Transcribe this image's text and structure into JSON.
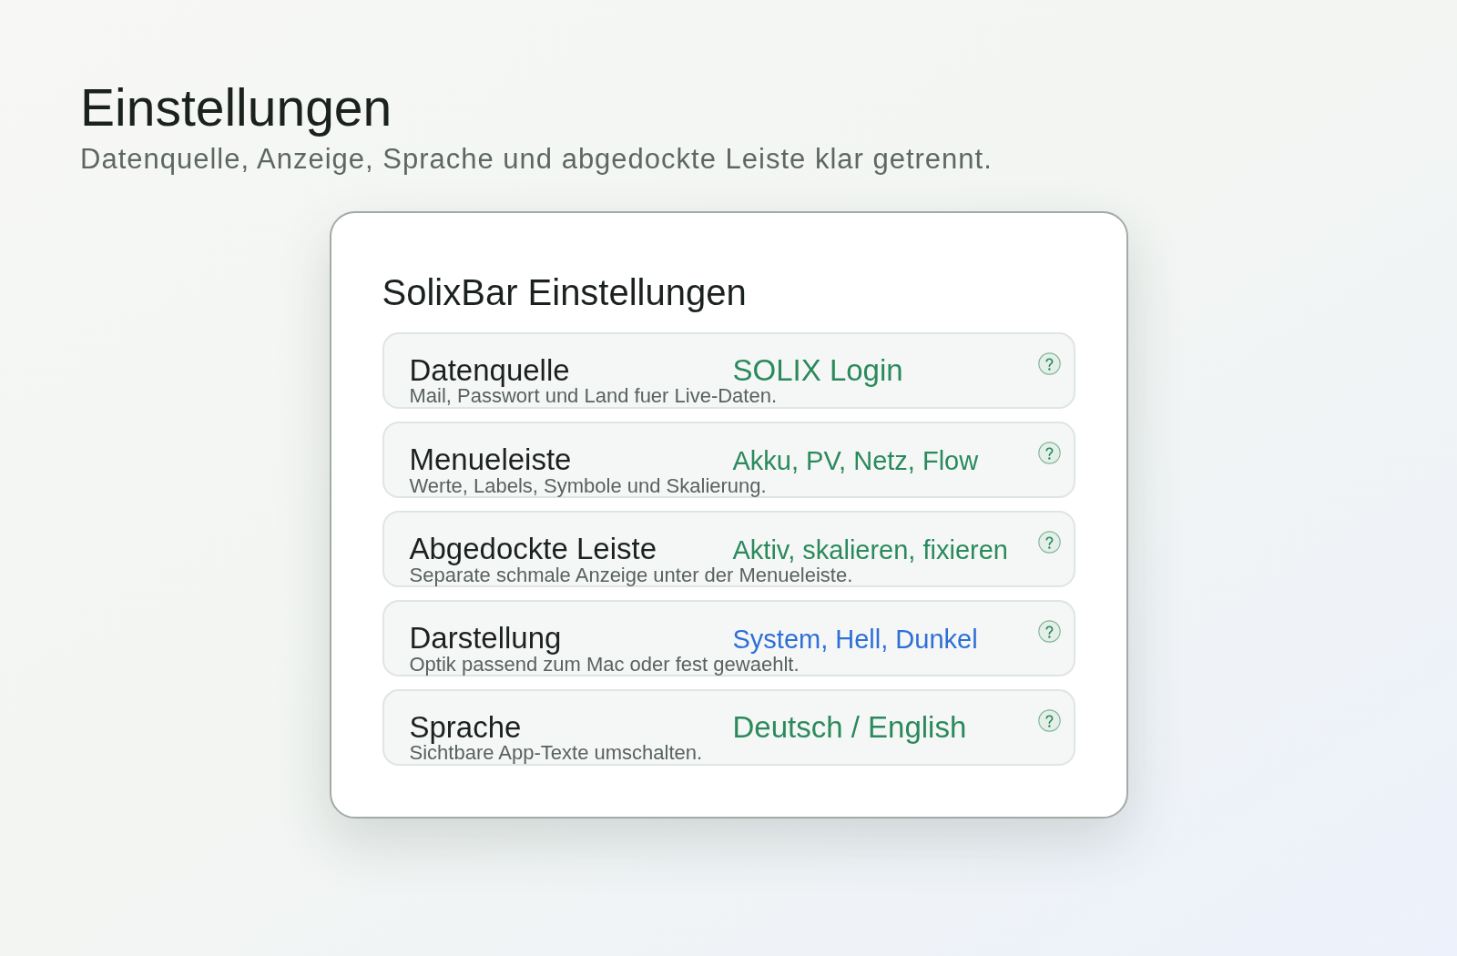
{
  "page": {
    "title": "Einstellungen",
    "subtitle": "Datenquelle, Anzeige, Sprache und abgedockte Leiste klar getrennt."
  },
  "settings_window": {
    "title": "SolixBar Einstellungen",
    "rows": [
      {
        "title": "Datenquelle",
        "description": "Mail, Passwort und Land fuer Live-Daten.",
        "value": "SOLIX Login",
        "color": "#2b8a5c"
      },
      {
        "title": "Menueleiste",
        "description": "Werte, Labels, Symbole und Skalierung.",
        "value": "Akku, PV, Netz, Flow",
        "color": "#2b8a5c"
      },
      {
        "title": "Abgedockte Leiste",
        "description": "Separate schmale Anzeige unter der Menueleiste.",
        "value": "Aktiv, skalieren, fixieren",
        "color": "#2b8a5c"
      },
      {
        "title": "Darstellung",
        "description": "Optik passend zum Mac oder fest gewaehlt.",
        "value": "System, Hell, Dunkel",
        "color": "#2f6fd6"
      },
      {
        "title": "Sprache",
        "description": "Sichtbare App-Texte umschalten.",
        "value": "Deutsch / English",
        "color": "#2b8a5c"
      }
    ]
  }
}
